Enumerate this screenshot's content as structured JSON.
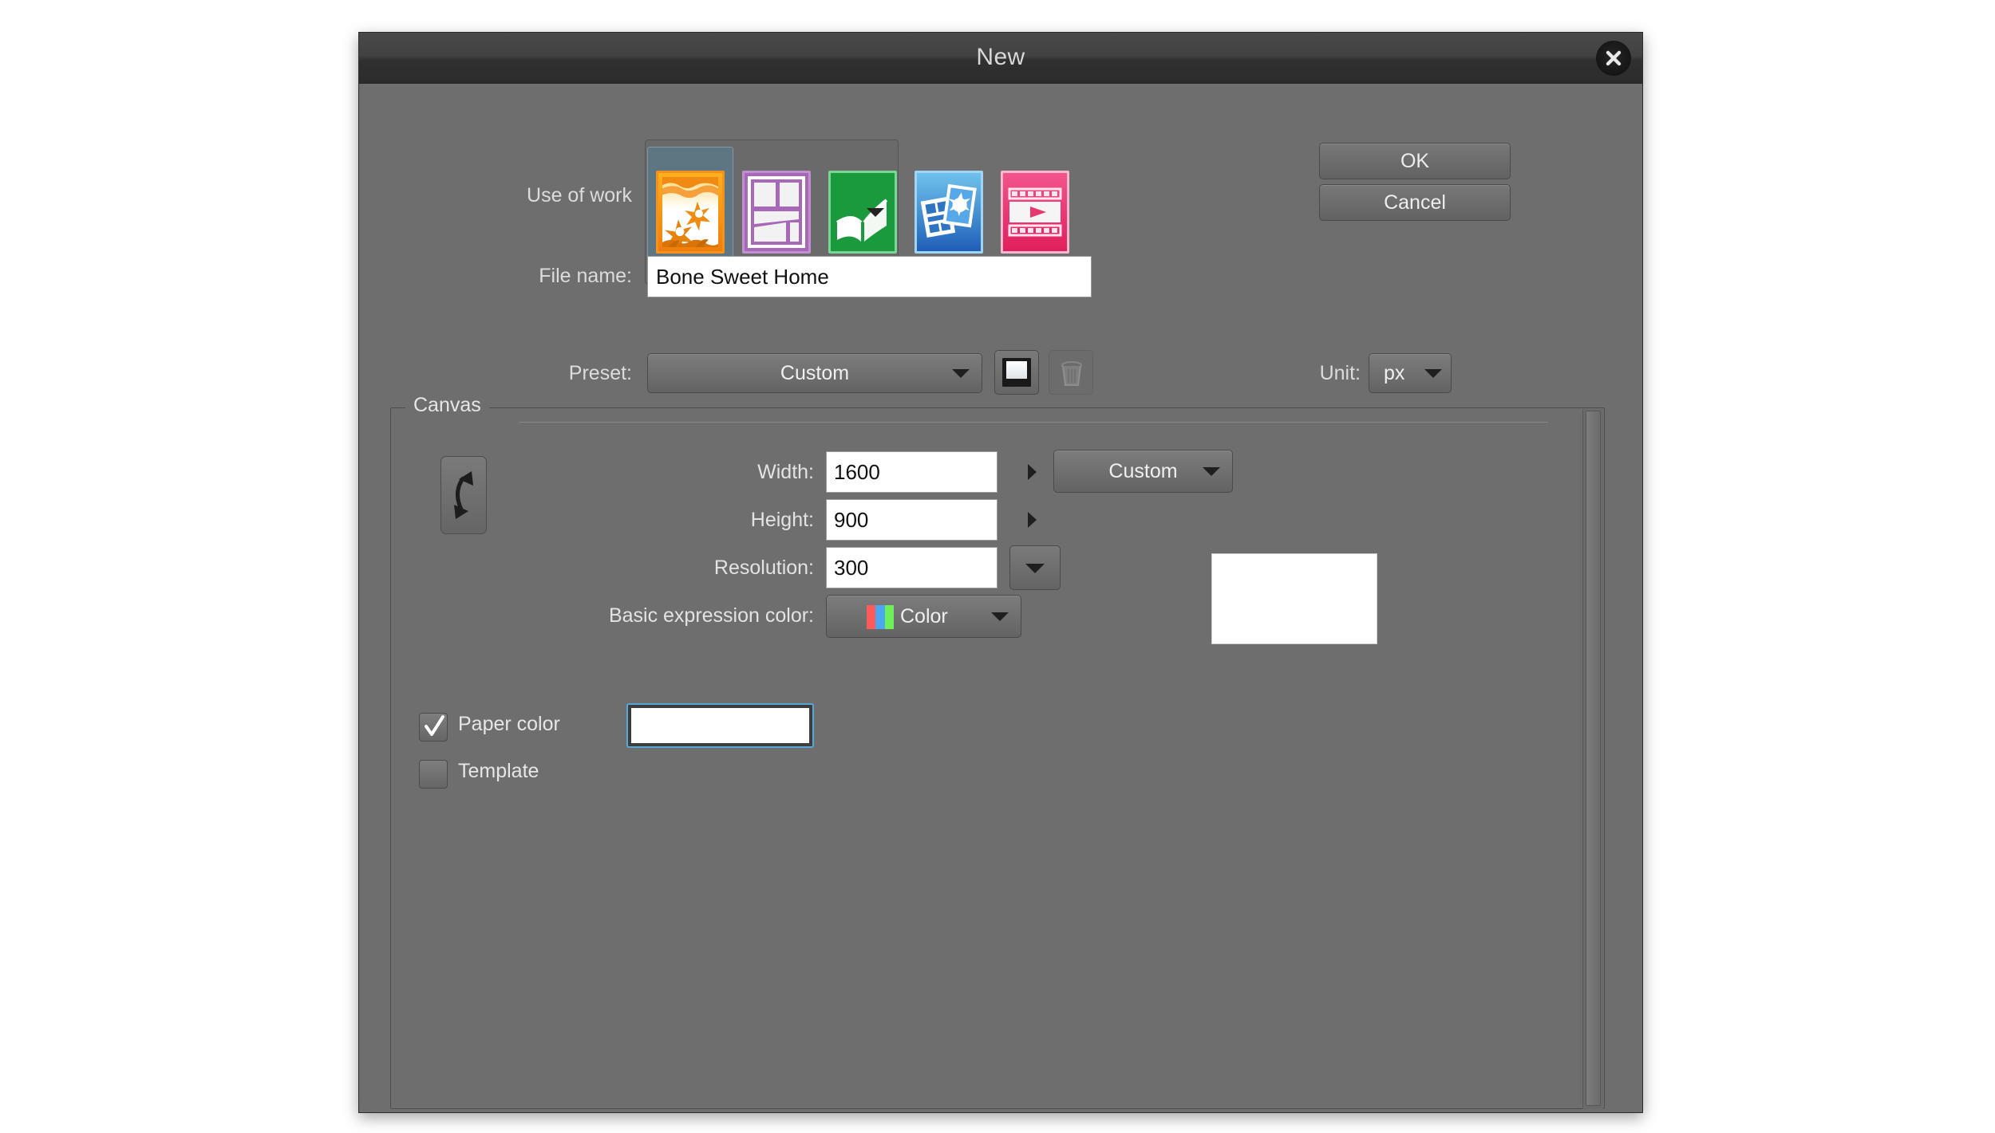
{
  "window": {
    "title": "New",
    "close_icon": "close-icon"
  },
  "use_of_work": {
    "label": "Use of work",
    "items": [
      {
        "name": "illustration",
        "selected": true
      },
      {
        "name": "comic",
        "selected": false
      },
      {
        "name": "book",
        "selected": false
      },
      {
        "name": "all-comic-settings",
        "selected": false
      },
      {
        "name": "animation",
        "selected": false
      }
    ],
    "expand_icon": "chevron-down-icon"
  },
  "buttons": {
    "ok": "OK",
    "cancel": "Cancel"
  },
  "file_name": {
    "label": "File name:",
    "value": "Bone Sweet Home"
  },
  "preset": {
    "label": "Preset:",
    "value": "Custom",
    "save_icon": "register-preset-icon",
    "delete_icon": "trash-icon"
  },
  "unit": {
    "label": "Unit:",
    "value": "px"
  },
  "canvas": {
    "legend": "Canvas",
    "swap_icon": "swap-width-height-icon",
    "width": {
      "label": "Width:",
      "value": "1600"
    },
    "height": {
      "label": "Height:",
      "value": "900"
    },
    "size_preset": "Custom",
    "resolution": {
      "label": "Resolution:",
      "value": "300"
    },
    "expression_color": {
      "label": "Basic expression color:",
      "value": "Color"
    },
    "paper_color": {
      "label": "Paper color",
      "checked": true,
      "swatch_hex": "#ffffff"
    },
    "template": {
      "label": "Template",
      "checked": false
    },
    "preview_hex": "#ffffff"
  },
  "colors": {
    "dialog_bg": "#6e6e6e",
    "titlebar_bg": "#3a3a3a",
    "focus_ring": "#55a8d8",
    "selected_cell": "#5d7682",
    "icon_illustration": "#f5921e",
    "icon_comic": "#a868b8",
    "icon_book": "#1a9a3c",
    "icon_photo": "#2b6fc4",
    "icon_animation": "#e8376f",
    "rgb_red": "#ff5a5a",
    "rgb_blue": "#4aa8f0",
    "rgb_green": "#6ef05a"
  }
}
